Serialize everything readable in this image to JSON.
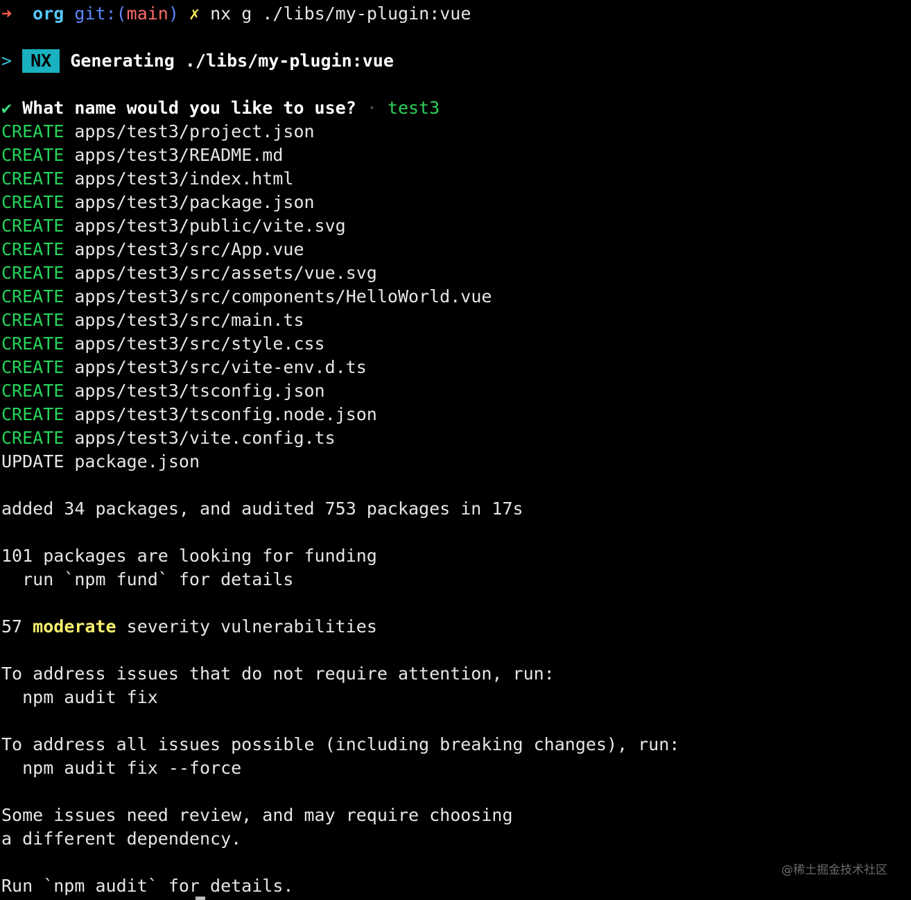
{
  "prompt": {
    "arrow": "➜",
    "dir": "org",
    "git_label": "git:(",
    "branch": "main",
    "git_close": ")",
    "dirty_mark": "✗",
    "command": "nx g ./libs/my-plugin:vue"
  },
  "generator": {
    "caret": ">",
    "badge": "NX",
    "text": "Generating ./libs/my-plugin:vue"
  },
  "question": {
    "check": "✔",
    "text": "What name would you like to use?",
    "separator": "·",
    "answer": "test3"
  },
  "file_ops": [
    {
      "action": "CREATE",
      "path": "apps/test3/project.json"
    },
    {
      "action": "CREATE",
      "path": "apps/test3/README.md"
    },
    {
      "action": "CREATE",
      "path": "apps/test3/index.html"
    },
    {
      "action": "CREATE",
      "path": "apps/test3/package.json"
    },
    {
      "action": "CREATE",
      "path": "apps/test3/public/vite.svg"
    },
    {
      "action": "CREATE",
      "path": "apps/test3/src/App.vue"
    },
    {
      "action": "CREATE",
      "path": "apps/test3/src/assets/vue.svg"
    },
    {
      "action": "CREATE",
      "path": "apps/test3/src/components/HelloWorld.vue"
    },
    {
      "action": "CREATE",
      "path": "apps/test3/src/main.ts"
    },
    {
      "action": "CREATE",
      "path": "apps/test3/src/style.css"
    },
    {
      "action": "CREATE",
      "path": "apps/test3/src/vite-env.d.ts"
    },
    {
      "action": "CREATE",
      "path": "apps/test3/tsconfig.json"
    },
    {
      "action": "CREATE",
      "path": "apps/test3/tsconfig.node.json"
    },
    {
      "action": "CREATE",
      "path": "apps/test3/vite.config.ts"
    },
    {
      "action": "UPDATE",
      "path": "package.json"
    }
  ],
  "npm": {
    "added": "added 34 packages, and audited 753 packages in 17s",
    "funding": "101 packages are looking for funding",
    "funding_hint": "  run `npm fund` for details",
    "vuln_count": "57",
    "vuln_level": "moderate",
    "vuln_rest": "severity vulnerabilities",
    "fix_intro": "To address issues that do not require attention, run:",
    "fix_cmd": "  npm audit fix",
    "force_intro": "To address all issues possible (including breaking changes), run:",
    "force_cmd": "  npm audit fix --force",
    "review_1": "Some issues need review, and may require choosing",
    "review_2": "a different dependency.",
    "run_audit": "Run `npm audit` for details."
  },
  "watermark": "@稀土掘金技术社区",
  "colors": {
    "background": "#000000",
    "create": "#26d45a",
    "nx_badge": "#19b0c0",
    "moderate": "#f7f06d"
  }
}
